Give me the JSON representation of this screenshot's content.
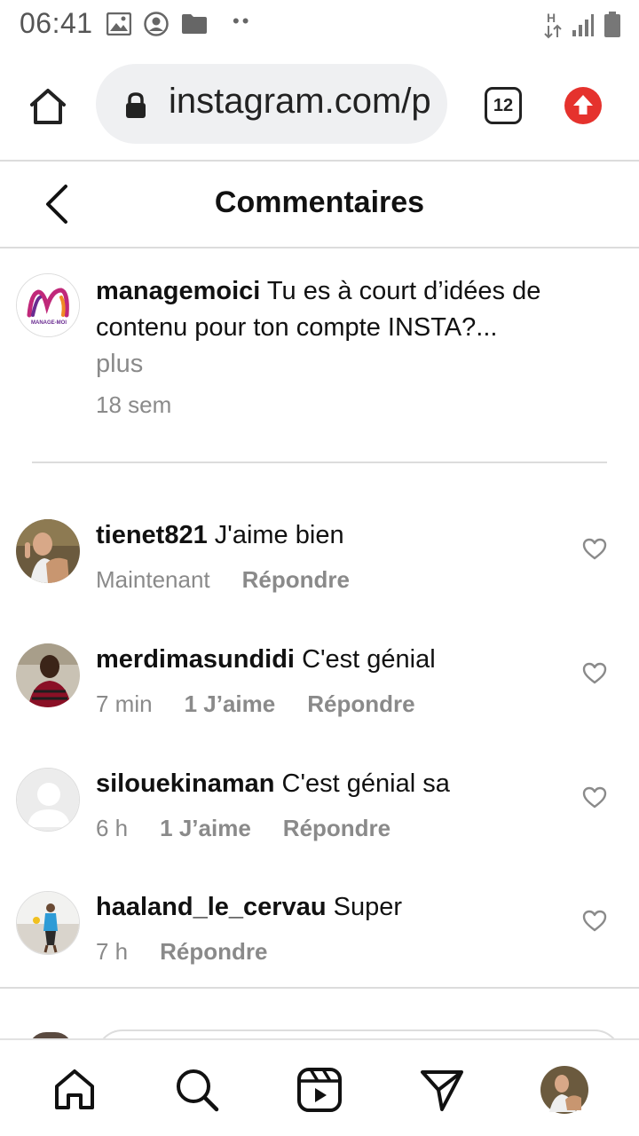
{
  "status_bar": {
    "time": "06:41",
    "icons": [
      "image-notification-icon",
      "account-circle-icon",
      "folder-icon",
      "more-dots-icon",
      "network-hspa-icon",
      "signal-icon",
      "battery-icon"
    ],
    "network_label": "H"
  },
  "browser": {
    "url": "instagram.com/p",
    "tab_count": "12",
    "icons": [
      "home-icon",
      "lock-icon",
      "tabs-icon",
      "update-available-icon"
    ]
  },
  "header": {
    "title": "Commentaires"
  },
  "caption": {
    "username": "managemoici",
    "text": "Tu es à court d’idées de contenu pour ton compte INSTA?...",
    "more": "plus",
    "time": "18 sem",
    "avatar_text": "MANAGE-MOI"
  },
  "comments": [
    {
      "username": "tienet821",
      "text": "J'aime bien",
      "time": "Maintenant",
      "likes": "",
      "reply": "Répondre"
    },
    {
      "username": "merdimasundidi",
      "text": "C'est génial",
      "time": "7 min",
      "likes": "1 J’aime",
      "reply": "Répondre"
    },
    {
      "username": "silouekinaman",
      "text": "C'est génial sa",
      "time": "6 h",
      "likes": "1 J’aime",
      "reply": "Répondre"
    },
    {
      "username": "haaland_le_cervau",
      "text": "Super",
      "time": "7 h",
      "likes": "",
      "reply": "Répondre"
    }
  ],
  "bottom_nav": [
    "home-icon",
    "search-icon",
    "reels-icon",
    "direct-message-icon",
    "profile-avatar"
  ],
  "colors": {
    "accent_red": "#e5322d",
    "muted_text": "#8a8a8a",
    "url_bar_bg": "#eff0f2",
    "logo_magenta": "#c0287a",
    "logo_purple": "#6a2c91",
    "logo_orange": "#f08a24"
  }
}
